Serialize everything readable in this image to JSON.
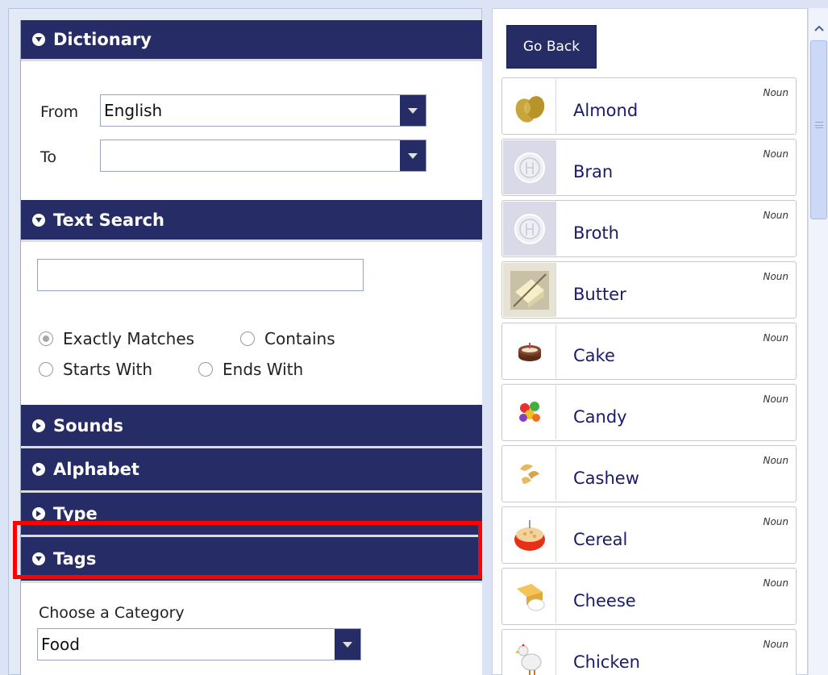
{
  "dictionary": {
    "header": "Dictionary",
    "from_label": "From",
    "from_value": "English",
    "to_label": "To",
    "to_value": ""
  },
  "text_search": {
    "header": "Text Search",
    "query": "",
    "options": [
      "Exactly Matches",
      "Contains",
      "Starts With",
      "Ends With"
    ],
    "selected": "Exactly Matches"
  },
  "collapsed_sections": [
    "Sounds",
    "Alphabet",
    "Type"
  ],
  "tags": {
    "header": "Tags",
    "category_label": "Choose a Category",
    "category_value": "Food"
  },
  "right_panel": {
    "go_back_label": "Go Back",
    "items": [
      {
        "word": "Almond",
        "pos": "Noun",
        "icon": "almond-icon"
      },
      {
        "word": "Bran",
        "pos": "Noun",
        "icon": "placeholder-icon"
      },
      {
        "word": "Broth",
        "pos": "Noun",
        "icon": "placeholder-icon"
      },
      {
        "word": "Butter",
        "pos": "Noun",
        "icon": "butter-icon"
      },
      {
        "word": "Cake",
        "pos": "Noun",
        "icon": "cake-icon"
      },
      {
        "word": "Candy",
        "pos": "Noun",
        "icon": "candy-icon"
      },
      {
        "word": "Cashew",
        "pos": "Noun",
        "icon": "cashew-icon"
      },
      {
        "word": "Cereal",
        "pos": "Noun",
        "icon": "cereal-icon"
      },
      {
        "word": "Cheese",
        "pos": "Noun",
        "icon": "cheese-icon"
      },
      {
        "word": "Chicken",
        "pos": "Noun",
        "icon": "chicken-icon"
      }
    ]
  },
  "colors": {
    "header_bg": "#262d66",
    "link_text": "#1a1a6e",
    "highlight": "#ff0000"
  }
}
